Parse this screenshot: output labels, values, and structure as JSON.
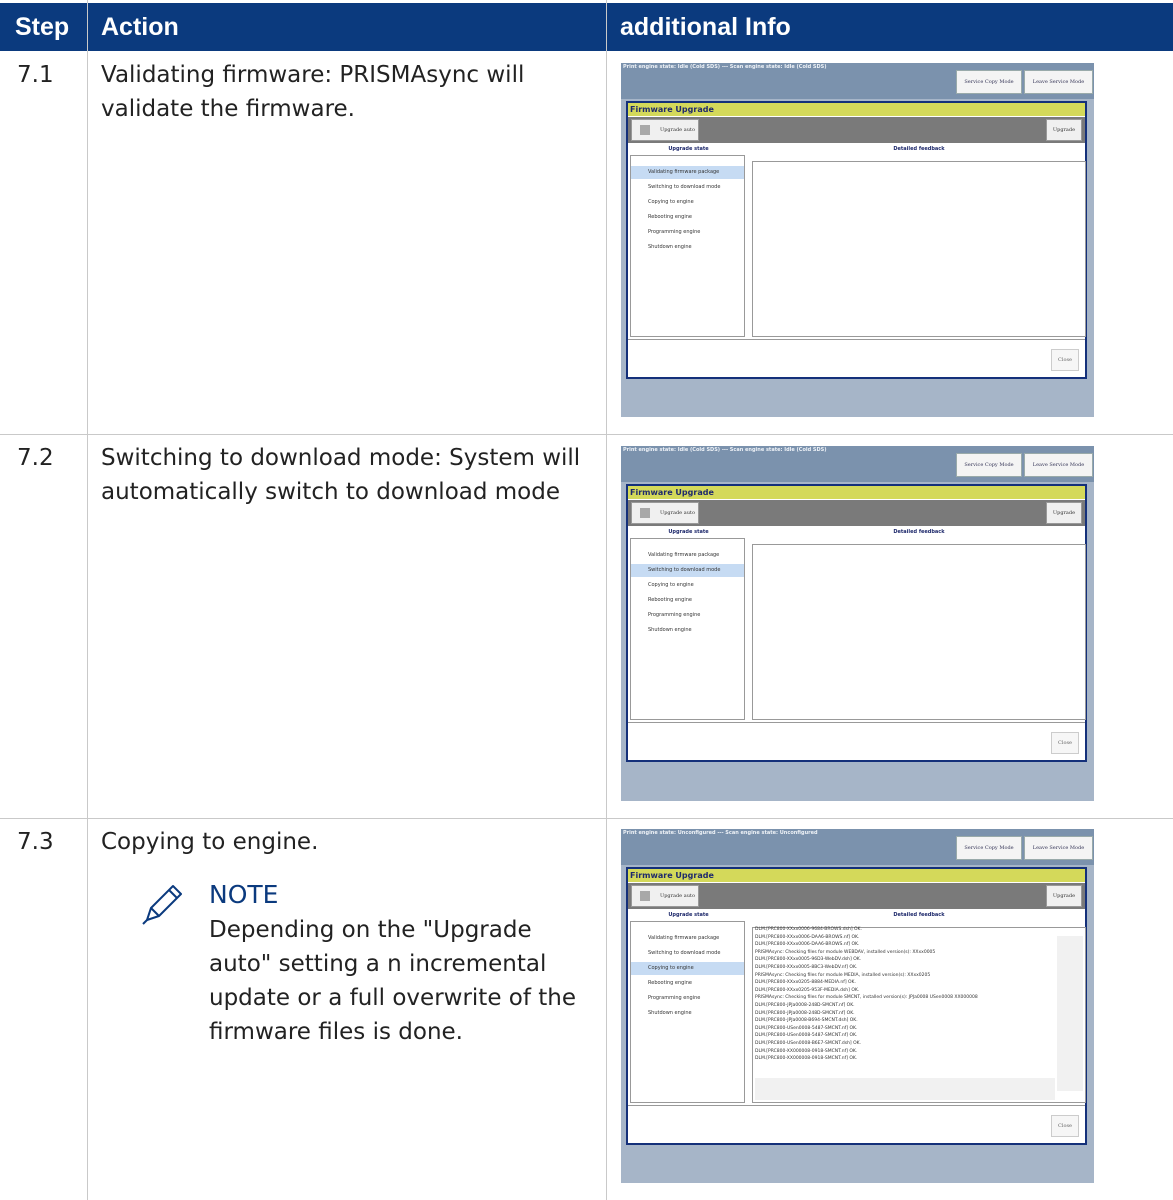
{
  "header": {
    "step": "Step",
    "action": "Action",
    "info": "additional Info"
  },
  "rows": [
    {
      "step": "7.1",
      "action": "Validating firmware: PRISMAsync will validate the firmware.",
      "shot": {
        "status": "Print engine state: Idle (Cold SDS) --- Scan engine state: Idle (Cold SDS)",
        "selected_index": 0,
        "log": []
      }
    },
    {
      "step": "7.2",
      "action": "Switching to download mode: System will automatically switch to download mode",
      "shot": {
        "status": "Print engine state: Idle (Cold SDS) --- Scan engine state: Idle (Cold SDS)",
        "selected_index": 1,
        "log": []
      }
    },
    {
      "step": "7.3",
      "action": "Copying to engine.",
      "note": {
        "title": "NOTE",
        "body": "Depending on the \"Upgrade auto\" setting a n incremental update or a full overwrite of the firmware files is done."
      },
      "shot": {
        "status": "Print engine state: Unconfigured --- Scan engine state: Unconfigured",
        "selected_index": 2,
        "log": [
          "DLM.[PRC800-XXxx0006-9684-BROWS.dsh] OK.",
          "DLM.[PRC800-XXxx0006-DAA6-BROWS.nf] OK.",
          "DLM.[PRC800-XXxx0006-DAA6-BROWS.nf] OK.",
          "PRISMAsync: Checking files for module WEBDAV, installed version(s): XXxx0005",
          "DLM.[PRC800-XXxx0005-96D3-WebDV.dsh] OK.",
          "DLM.[PRC800-XXxx0005-8BC3-WebDV.nf] OK.",
          "PRISMAsync: Checking files for module MEDIA, installed version(s): XXxx0205",
          "DLM.[PRC800-XXxx0205-8884-MEDIA.nf] OK.",
          "DLM.[PRC800-XXxx0205-953F-MEDIA.dsh] OK.",
          "PRISMAsync: Checking files for module SMCNT, installed version(s): JPJa0008 USen0008 XX000008",
          "DLM.[PRC800-JPJa0008-248D-SMCNT.nf] OK.",
          "DLM.[PRC800-JPJa0008-248D-SMCNT.nf] OK.",
          "DLM.[PRC800-JPJa0008-B694-SMCNT.dsh] OK.",
          "DLM.[PRC800-USen0008-5487-SMCNT.nf] OK.",
          "DLM.[PRC800-USen0008-5487-SMCNT.nf] OK.",
          "DLM.[PRC800-USen0008-B6E7-SMCNT.dsh] OK.",
          "DLM.[PRC800-XX000008-0918-SMCNT.nf] OK.",
          "DLM.[PRC800-XX000008-0918-SMCNT.nf] OK."
        ]
      }
    }
  ],
  "dialog": {
    "service_copy_mode": "Service Copy Mode",
    "leave_service_mode": "Leave Service Mode",
    "title": "Firmware Upgrade",
    "upgrade_auto": "Upgrade auto",
    "upgrade": "Upgrade",
    "upgrade_state": "Upgrade state",
    "detailed_feedback": "Detailed feedback",
    "close": "Close",
    "states": [
      "Validating firmware package",
      "Switching to download mode",
      "Copying to engine",
      "Rebooting engine",
      "Programming engine",
      "Shutdown engine"
    ]
  }
}
